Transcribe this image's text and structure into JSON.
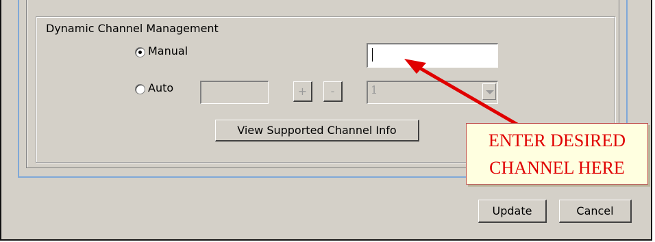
{
  "group": {
    "title": "Dynamic Channel Management"
  },
  "manual": {
    "label": "Manual",
    "selected": true,
    "value": ""
  },
  "auto": {
    "label": "Auto",
    "selected": false,
    "value": "",
    "plus_label": "+",
    "minus_label": "-",
    "select_value": "1"
  },
  "view_info_button": "View Supported Channel Info",
  "callout": {
    "line1": "ENTER DESIRED",
    "line2": "CHANNEL HERE"
  },
  "footer": {
    "update_label": "Update",
    "cancel_label": "Cancel"
  },
  "colors": {
    "annotation": "#e00000",
    "callout_bg": "#ffffe0",
    "dialog_bg": "#d4d0c8"
  }
}
